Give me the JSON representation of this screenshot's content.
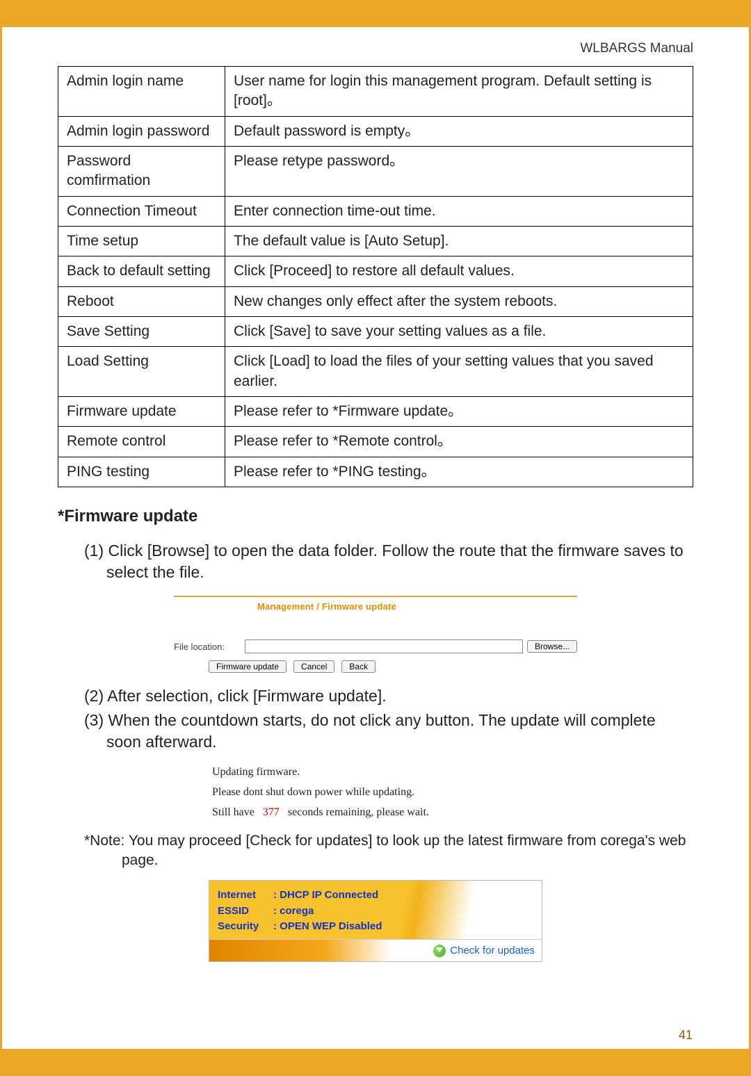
{
  "header": {
    "manual_title": "WLBARGS Manual"
  },
  "table": {
    "rows": [
      {
        "k": "Admin login name",
        "v": "User name for login this management program. Default setting is [root]。"
      },
      {
        "k": "Admin login password",
        "v": "Default password is empty。"
      },
      {
        "k": "Password comfirmation",
        "v": "Please retype password。"
      },
      {
        "k": "Connection Timeout",
        "v": "Enter connection time-out time."
      },
      {
        "k": "Time setup",
        "v": "The default value is [Auto Setup]."
      },
      {
        "k": "Back to default setting",
        "v": "Click [Proceed] to restore all default values."
      },
      {
        "k": "Reboot",
        "v": "New changes only effect after the system reboots."
      },
      {
        "k": "Save Setting",
        "v": "Click [Save] to save your setting values as a file."
      },
      {
        "k": "Load Setting",
        "v": "Click [Load] to load the files of your setting values that you saved earlier."
      },
      {
        "k": "Firmware update",
        "v": "Please refer to *Firmware update。"
      },
      {
        "k": "Remote control",
        "v": "Please refer to *Remote control。"
      },
      {
        "k": "PING testing",
        "v": "Please refer to *PING testing。"
      }
    ]
  },
  "section": {
    "heading": "*Firmware update"
  },
  "steps": {
    "s1": "(1) Click [Browse] to open the data folder.  Follow the route that the firmware saves to select the file.",
    "s2": "(2) After selection, click [Firmware update].",
    "s3": "(3) When the countdown starts, do not click any button.  The update will complete soon afterward."
  },
  "note": "*Note: You may proceed [Check for updates] to look up the latest firmware from corega's web page.",
  "shot1": {
    "crumb": "Management / Firmware update",
    "file_label": "File location:",
    "browse": "Browse...",
    "btn_update": "Firmware update",
    "btn_cancel": "Cancel",
    "btn_back": "Back"
  },
  "shot2": {
    "line1": "Updating firmware.",
    "line2": "Please dont shut down power while updating.",
    "line3a": "Still have",
    "seconds": "377",
    "line3b": "seconds remaining, please wait."
  },
  "shot3": {
    "internet_k": "Internet",
    "internet_v": ": DHCP IP Connected",
    "essid_k": "ESSID",
    "essid_v": ": corega",
    "security_k": "Security",
    "security_v": ": OPEN  WEP Disabled",
    "check": "Check for updates"
  },
  "page_number": "41"
}
